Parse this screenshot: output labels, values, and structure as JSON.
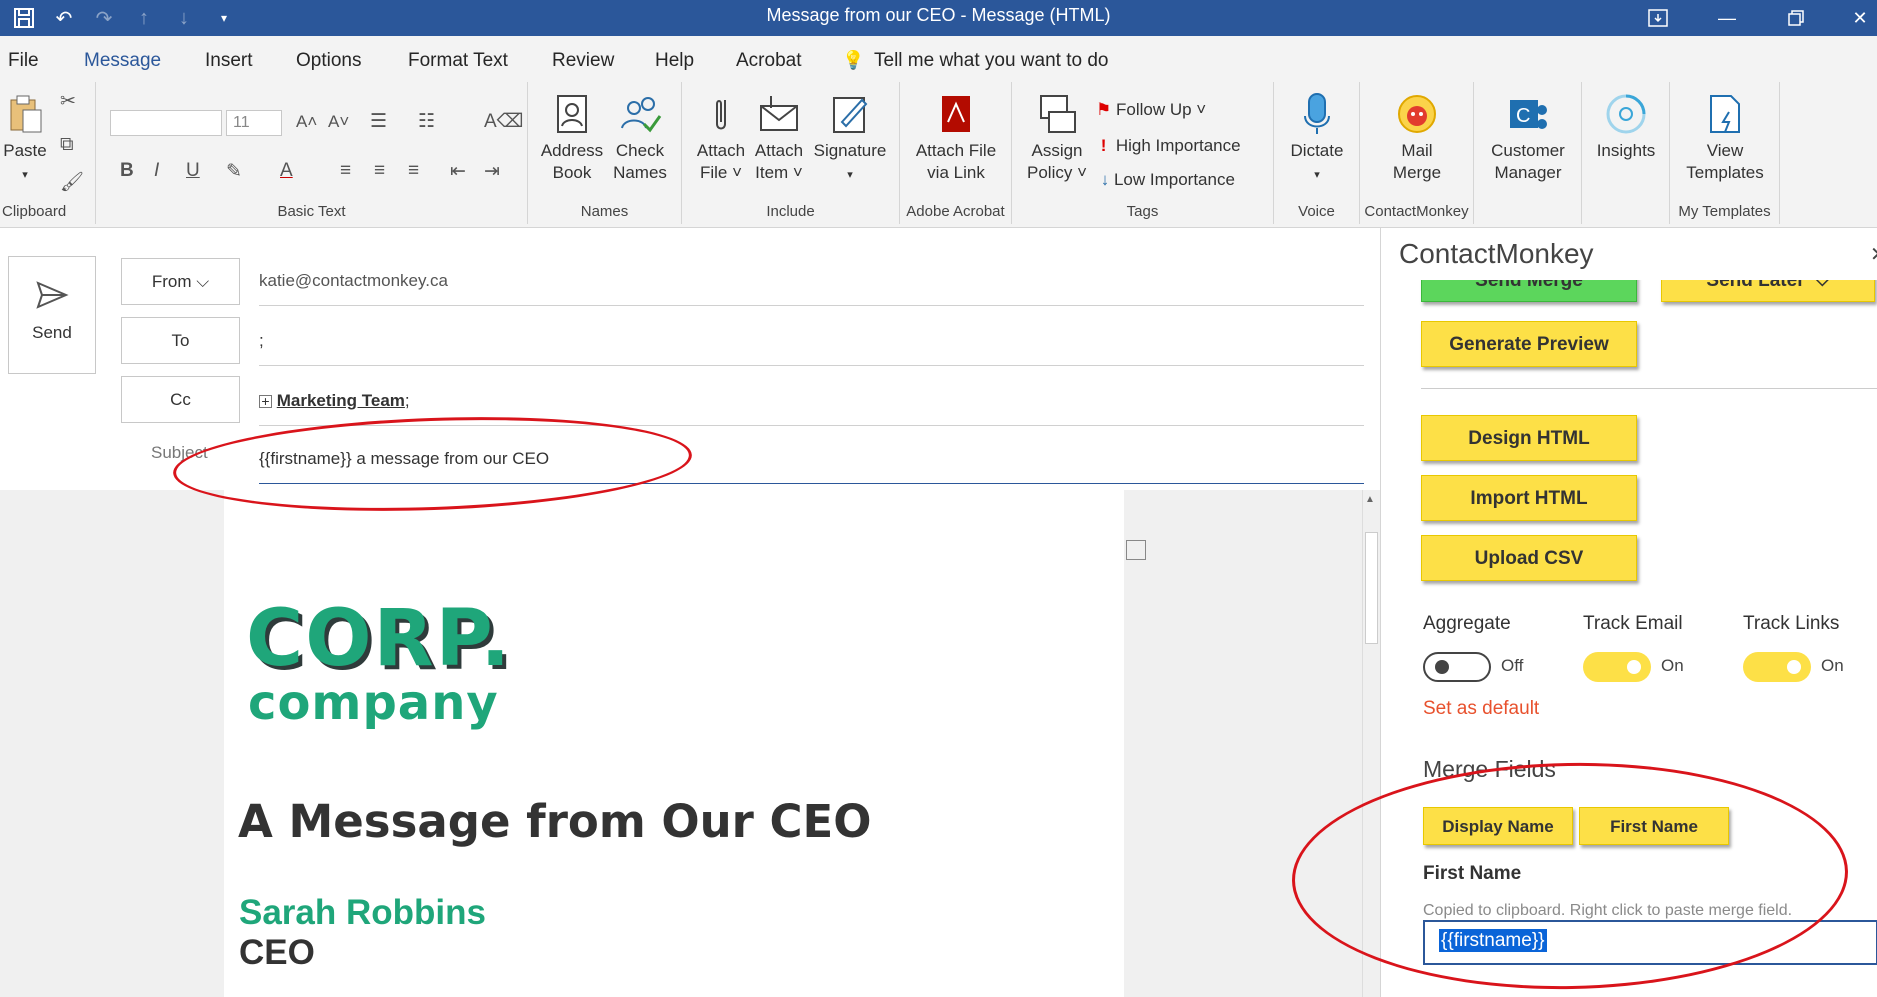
{
  "window": {
    "title": "Message from our CEO  -  Message (HTML)"
  },
  "menu": {
    "file": "File",
    "message": "Message",
    "insert": "Insert",
    "options": "Options",
    "format_text": "Format Text",
    "review": "Review",
    "help": "Help",
    "acrobat": "Acrobat",
    "tell_me": "Tell me what you want to do"
  },
  "ribbon": {
    "paste": "Paste",
    "clipboard": "Clipboard",
    "font_size": "11",
    "basic_text": "Basic Text",
    "address_book_1": "Address",
    "address_book_2": "Book",
    "check_names_1": "Check",
    "check_names_2": "Names",
    "names": "Names",
    "attach_file_1": "Attach",
    "attach_file_2": "File ˅",
    "attach_item_1": "Attach",
    "attach_item_2": "Item ˅",
    "signature": "Signature",
    "include": "Include",
    "attach_link_1": "Attach File",
    "attach_link_2": "via Link",
    "adobe_acrobat": "Adobe Acrobat",
    "assign_policy_1": "Assign",
    "assign_policy_2": "Policy ˅",
    "follow_up": "Follow Up ˅",
    "high_importance": "High Importance",
    "low_importance": "Low Importance",
    "tags": "Tags",
    "dictate": "Dictate",
    "voice": "Voice",
    "mail_merge_1": "Mail",
    "mail_merge_2": "Merge",
    "contactmonkey": "ContactMonkey",
    "customer_manager_1": "Customer",
    "customer_manager_2": "Manager",
    "insights": "Insights",
    "view_templates_1": "View",
    "view_templates_2": "Templates",
    "my_templates": "My Templates"
  },
  "compose": {
    "send": "Send",
    "from_label": "From",
    "from_value": "katie@contactmonkey.ca",
    "to_label": "To",
    "to_value": ";",
    "cc_label": "Cc",
    "cc_value": "Marketing Team",
    "cc_suffix": ";",
    "subject_label": "Subject",
    "subject_value": "{{firstname}} a message from our CEO"
  },
  "email": {
    "logo_line1": "CORP.",
    "logo_line2": "company",
    "heading": "A Message from Our CEO",
    "name": "Sarah Robbins",
    "role": "CEO"
  },
  "pane": {
    "title": "ContactMonkey",
    "send_merge": "Send Merge",
    "send_later": "Send Later",
    "generate_preview": "Generate Preview",
    "design_html": "Design HTML",
    "import_html": "Import HTML",
    "upload_csv": "Upload CSV",
    "aggregate": "Aggregate",
    "aggregate_state": "Off",
    "track_email": "Track Email",
    "track_email_state": "On",
    "track_links": "Track Links",
    "track_links_state": "On",
    "set_default": "Set as default",
    "merge_fields": "Merge Fields",
    "display_name": "Display Name",
    "first_name": "First Name",
    "selected_field": "First Name",
    "copied_msg": "Copied to clipboard. Right click to paste merge field.",
    "merge_value": "{{firstname}}"
  },
  "colors": {
    "accent": "#2b579a",
    "yellow": "#fde047",
    "green_logo": "#1fa67a",
    "annotation": "#d9141b",
    "link_orange": "#e8512d"
  }
}
